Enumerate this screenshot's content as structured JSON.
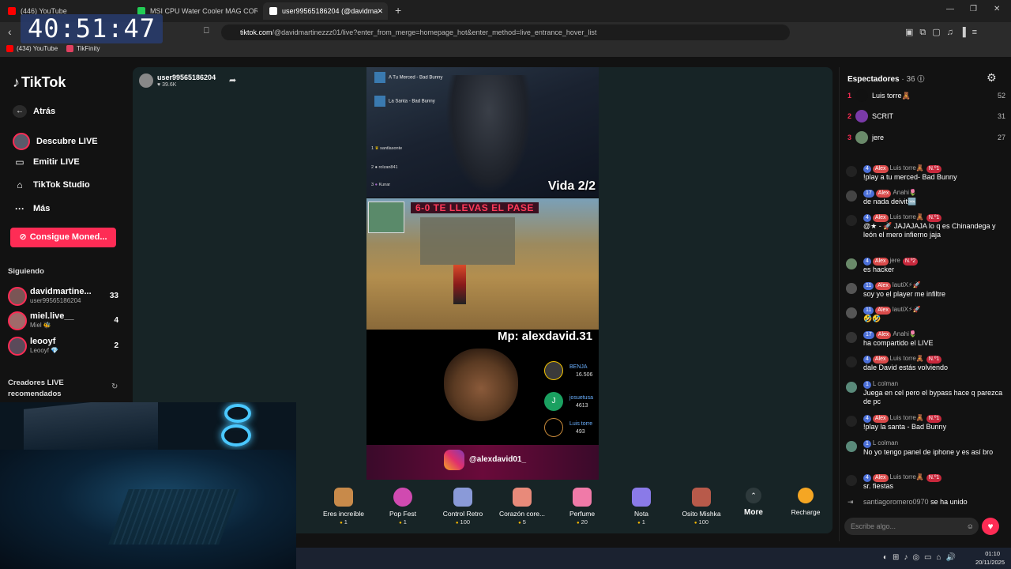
{
  "tabs": [
    {
      "label": "(446) YouTube",
      "color": "#ff0000"
    },
    {
      "label": "MSI CPU Water Cooler MAG CORELIQ",
      "color": "#22cc55"
    },
    {
      "label": "user99565186204 (@davidma",
      "color": "#ffffff"
    }
  ],
  "window": {
    "minimize": "—",
    "maximize": "❐",
    "close": "✕",
    "new_tab": "+"
  },
  "clock": "40:51:47",
  "address": {
    "host": "tiktok.com",
    "path": "/@davidmartinezzz01/live?enter_from_merge=homepage_hot&enter_method=live_entrance_hover_list"
  },
  "bookmarks": [
    {
      "label": "(434) YouTube"
    },
    {
      "label": "TikFinity"
    }
  ],
  "sidebar": {
    "logo": "TikTok",
    "nav": [
      {
        "label": "Atrás",
        "icon": "←"
      },
      {
        "label": "Descubre LIVE",
        "icon": "◉"
      },
      {
        "label": "Emitir LIVE",
        "icon": "▭"
      },
      {
        "label": "TikTok Studio",
        "icon": "⌂"
      },
      {
        "label": "Más",
        "icon": "···"
      }
    ],
    "coins_button": "Consigue Moned...",
    "following_title": "Siguiendo",
    "following": [
      {
        "name": "davidmartine...",
        "sub": "user99565186204",
        "count": "33"
      },
      {
        "name": "miel.live__",
        "sub": "Miel 🐝",
        "count": "4"
      },
      {
        "name": "leooyf",
        "sub": "Leooyf 💎",
        "count": "2"
      }
    ],
    "recommended_title": "Creadores LIVE recomendados"
  },
  "streamer": {
    "name": "user99565186204",
    "likes": "39.6K"
  },
  "video": {
    "songs": [
      {
        "title": "A Tu Merced - Bad Bunny"
      },
      {
        "title": "La Santa - Bad Bunny"
      }
    ],
    "top_gifters_mini": [
      {
        "rank": "1",
        "name": "santlasonte"
      },
      {
        "rank": "2",
        "name": "rolzan841"
      },
      {
        "rank": "3",
        "name": "Kunar"
      }
    ],
    "lives": "Vida 2/2",
    "banner": "6-0 TE LLEVAS EL PASE",
    "mp": "Mp: alexdavid.31",
    "ranking": [
      {
        "name": "BENJA",
        "score": "16.506"
      },
      {
        "name": "josuetusa",
        "score": "4613"
      },
      {
        "name": "Luis torre",
        "score": "493"
      }
    ],
    "instagram": "@alexdavid01_"
  },
  "gifts": [
    {
      "name": "Eres increíble",
      "price": "1"
    },
    {
      "name": "Pop Fest",
      "price": "1"
    },
    {
      "name": "Control Retro",
      "price": "100"
    },
    {
      "name": "Corazón core...",
      "price": "5"
    },
    {
      "name": "Perfume",
      "price": "20"
    },
    {
      "name": "Nota",
      "price": "1"
    },
    {
      "name": "Osito Mishka",
      "price": "100"
    }
  ],
  "more_label": "More",
  "recharge_label": "Recharge",
  "chat": {
    "title": "Espectadores",
    "viewer_count": "· 36",
    "top_viewers": [
      {
        "rank": "1",
        "name": "Luis torre🧸",
        "score": "52"
      },
      {
        "rank": "2",
        "name": "SCRIT",
        "score": "31"
      },
      {
        "rank": "3",
        "name": "jere",
        "score": "27"
      }
    ],
    "messages": [
      {
        "lvl": "4",
        "fan": "Alex",
        "user": "Luis torre🧸",
        "rank": "N.º1",
        "text": "!play a tu merced- Bad Bunny"
      },
      {
        "lvl": "17",
        "fan": "Alex",
        "user": "Anahi🌷",
        "rank": "",
        "text": "de nada deivit🆒"
      },
      {
        "lvl": "4",
        "fan": "Alex",
        "user": "Luis torre🧸",
        "rank": "N.º1",
        "text": "@★ - 🚀 JAJAJAJA lo q es Chinandega y león el mero infierno jaja"
      },
      {
        "lvl": "4",
        "fan": "Alex",
        "user": "jere",
        "rank": "N.º2",
        "text": "es hacker"
      },
      {
        "lvl": "11",
        "fan": "Alex",
        "user": "lautiX⚡🚀",
        "rank": "",
        "text": "soy yo el player me infiltre"
      },
      {
        "lvl": "11",
        "fan": "Alex",
        "user": "lautiX⚡🚀",
        "rank": "",
        "text": "🤣🤣"
      },
      {
        "lvl": "17",
        "fan": "Alex",
        "user": "Anahi🌷",
        "rank": "",
        "text": "ha compartido el LIVE"
      },
      {
        "lvl": "4",
        "fan": "Alex",
        "user": "Luis torre🧸",
        "rank": "N.º1",
        "text": "dale David estás volviendo"
      },
      {
        "lvl": "1",
        "fan": "",
        "user": "L colman",
        "rank": "",
        "text": "Juega en cel pero el bypass hace q parezca de pc"
      },
      {
        "lvl": "4",
        "fan": "Alex",
        "user": "Luis torre🧸",
        "rank": "N.º1",
        "text": "!play la santa - Bad Bunny"
      },
      {
        "lvl": "1",
        "fan": "",
        "user": "L colman",
        "rank": "",
        "text": "No yo tengo panel de iphone y es así bro"
      },
      {
        "lvl": "4",
        "fan": "Alex",
        "user": "Luis torre🧸",
        "rank": "N.º1",
        "text": "sr. fiestas"
      }
    ],
    "join_user": "santiagoromero0970",
    "join_text": "se ha unido",
    "input_placeholder": "Escribe algo..."
  },
  "taskbar": {
    "time": "01:10",
    "date": "20/11/2025"
  }
}
